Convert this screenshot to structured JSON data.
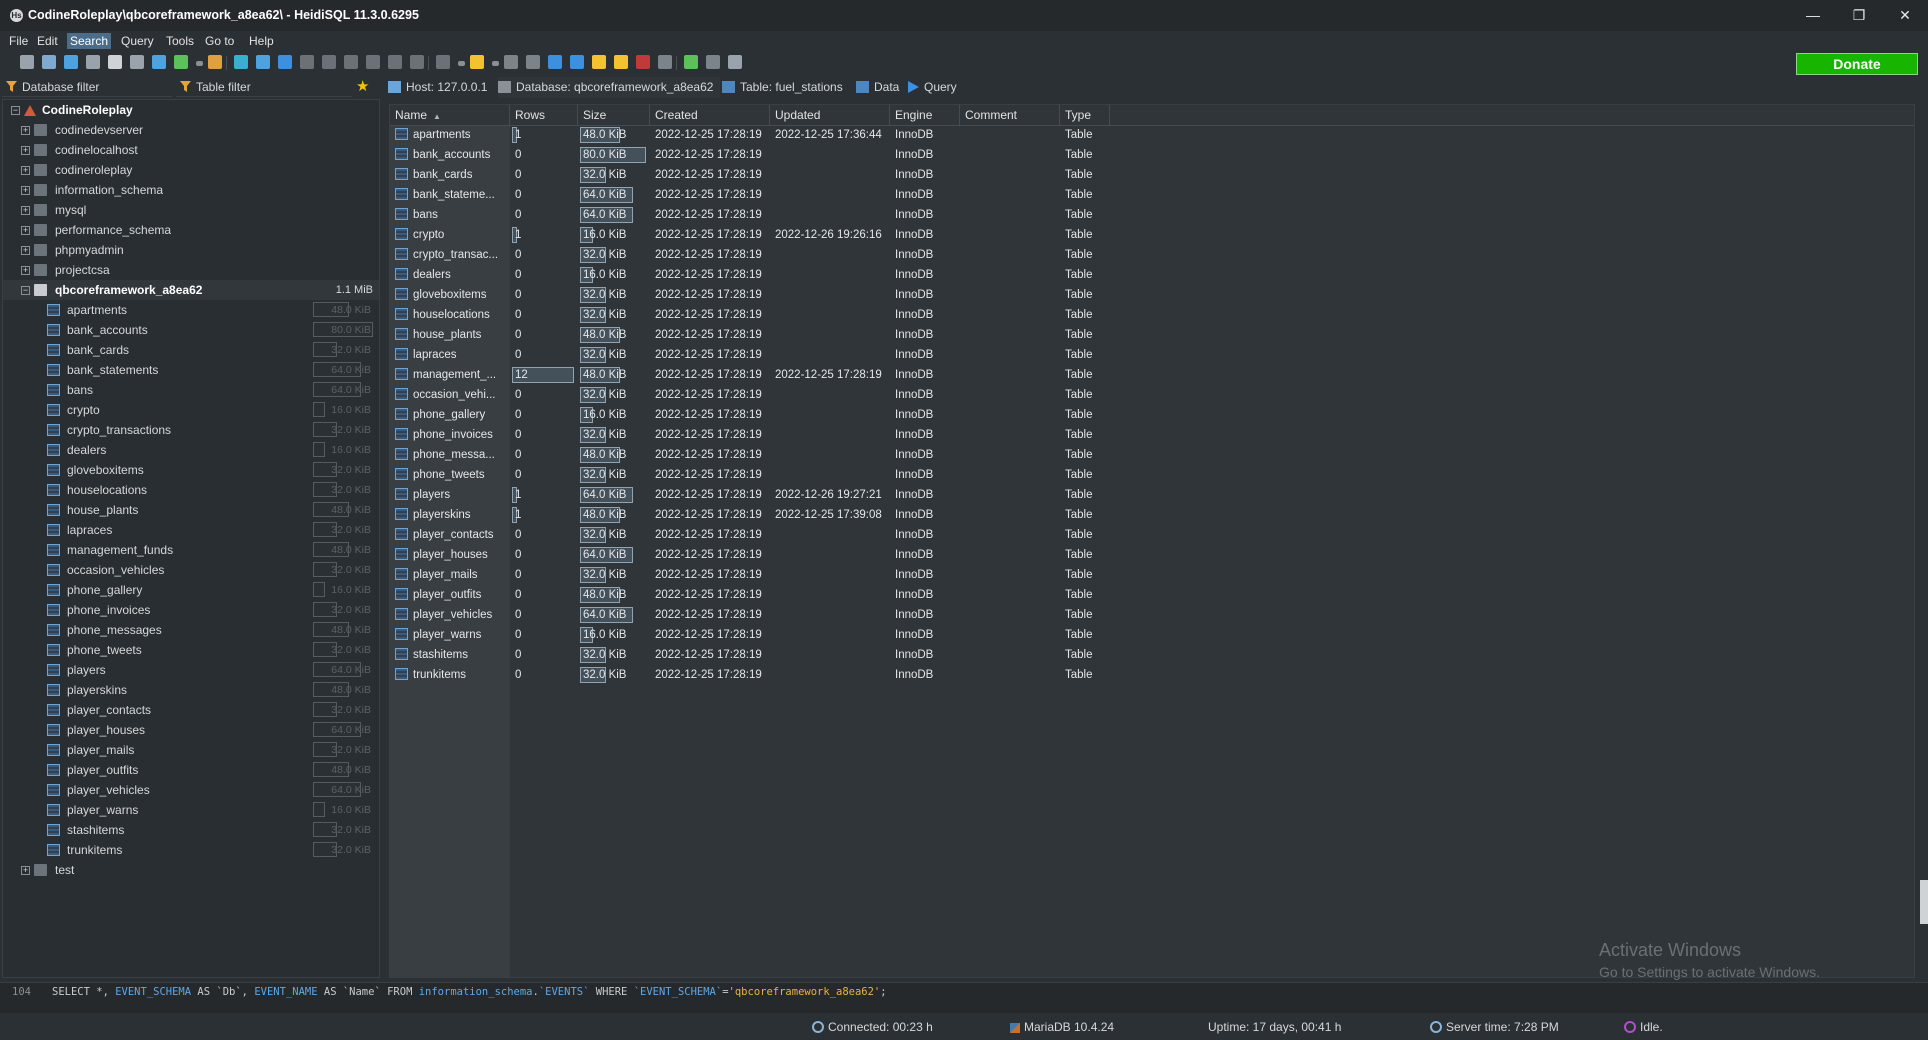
{
  "window": {
    "title": "CodineRoleplay\\qbcoreframework_a8ea62\\ - HeidiSQL 11.3.0.6295",
    "app_icon": "Hs",
    "controls": {
      "minimize": "—",
      "restore": "❐",
      "close": "✕"
    }
  },
  "menu": [
    "File",
    "Edit",
    "Search",
    "Query",
    "Tools",
    "Go to",
    "Help"
  ],
  "menu_active": "Search",
  "toolbar": {
    "donate_label": "Donate",
    "icons": [
      "connection-manager-icon",
      "disconnect-icon",
      "new-connection-icon",
      "copy-icon",
      "paste-icon",
      "undo-icon",
      "save-icon",
      "refresh-icon",
      "dropdown-icon",
      "user-manager-icon",
      "export-icon",
      "maintenance-icon",
      "help-icon",
      "first-icon",
      "last-icon",
      "insert-icon",
      "delete-icon",
      "post-icon",
      "cancel-icon",
      "run-icon",
      "run-dropdown-icon",
      "open-file-icon",
      "open-dropdown-icon",
      "save-sql-icon",
      "print-icon",
      "find-icon",
      "find-replace-icon",
      "format-icon",
      "warning-icon",
      "warnings-list-icon",
      "wrap-icon",
      "refresh-data-icon",
      "more-icon",
      "close-tab-icon"
    ]
  },
  "filters": {
    "database_filter": "Database filter",
    "table_filter": "Table filter"
  },
  "tabs": [
    {
      "label": "Host: 127.0.0.1",
      "icon": "host-icon",
      "active": false
    },
    {
      "label": "Database: qbcoreframework_a8ea62",
      "icon": "database-icon",
      "active": true
    },
    {
      "label": "Table: fuel_stations",
      "icon": "table-icon",
      "active": false
    },
    {
      "label": "Data",
      "icon": "grid-icon",
      "active": false
    },
    {
      "label": "Query",
      "icon": "play-icon",
      "active": false
    }
  ],
  "tree": {
    "root": "CodineRoleplay",
    "databases": [
      "codinedevserver",
      "codinelocalhost",
      "codineroleplay",
      "information_schema",
      "mysql",
      "performance_schema",
      "phpmyadmin",
      "projectcsa"
    ],
    "selected_db": {
      "name": "qbcoreframework_a8ea62",
      "size": "1.1 MiB"
    },
    "tables": [
      {
        "name": "apartments",
        "size": "48.0 KiB",
        "fraction": 0.6
      },
      {
        "name": "bank_accounts",
        "size": "80.0 KiB",
        "fraction": 1.0
      },
      {
        "name": "bank_cards",
        "size": "32.0 KiB",
        "fraction": 0.4
      },
      {
        "name": "bank_statements",
        "size": "64.0 KiB",
        "fraction": 0.8
      },
      {
        "name": "bans",
        "size": "64.0 KiB",
        "fraction": 0.8
      },
      {
        "name": "crypto",
        "size": "16.0 KiB",
        "fraction": 0.2
      },
      {
        "name": "crypto_transactions",
        "size": "32.0 KiB",
        "fraction": 0.4
      },
      {
        "name": "dealers",
        "size": "16.0 KiB",
        "fraction": 0.2
      },
      {
        "name": "gloveboxitems",
        "size": "32.0 KiB",
        "fraction": 0.4
      },
      {
        "name": "houselocations",
        "size": "32.0 KiB",
        "fraction": 0.4
      },
      {
        "name": "house_plants",
        "size": "48.0 KiB",
        "fraction": 0.6
      },
      {
        "name": "lapraces",
        "size": "32.0 KiB",
        "fraction": 0.4
      },
      {
        "name": "management_funds",
        "size": "48.0 KiB",
        "fraction": 0.6
      },
      {
        "name": "occasion_vehicles",
        "size": "32.0 KiB",
        "fraction": 0.4
      },
      {
        "name": "phone_gallery",
        "size": "16.0 KiB",
        "fraction": 0.2
      },
      {
        "name": "phone_invoices",
        "size": "32.0 KiB",
        "fraction": 0.4
      },
      {
        "name": "phone_messages",
        "size": "48.0 KiB",
        "fraction": 0.6
      },
      {
        "name": "phone_tweets",
        "size": "32.0 KiB",
        "fraction": 0.4
      },
      {
        "name": "players",
        "size": "64.0 KiB",
        "fraction": 0.8
      },
      {
        "name": "playerskins",
        "size": "48.0 KiB",
        "fraction": 0.6
      },
      {
        "name": "player_contacts",
        "size": "32.0 KiB",
        "fraction": 0.4
      },
      {
        "name": "player_houses",
        "size": "64.0 KiB",
        "fraction": 0.8
      },
      {
        "name": "player_mails",
        "size": "32.0 KiB",
        "fraction": 0.4
      },
      {
        "name": "player_outfits",
        "size": "48.0 KiB",
        "fraction": 0.6
      },
      {
        "name": "player_vehicles",
        "size": "64.0 KiB",
        "fraction": 0.8
      },
      {
        "name": "player_warns",
        "size": "16.0 KiB",
        "fraction": 0.2
      },
      {
        "name": "stashitems",
        "size": "32.0 KiB",
        "fraction": 0.4
      },
      {
        "name": "trunkitems",
        "size": "32.0 KiB",
        "fraction": 0.4
      }
    ],
    "after": [
      "test"
    ]
  },
  "grid": {
    "columns": [
      "Name",
      "Rows",
      "Size",
      "Created",
      "Updated",
      "Engine",
      "Comment",
      "Type"
    ],
    "sort_indicator": "▲",
    "rows": [
      {
        "name": "apartments",
        "rows": "1",
        "rows_fraction": 0.08,
        "size": "48.0 KiB",
        "size_fraction": 0.6,
        "created": "2022-12-25 17:28:19",
        "updated": "2022-12-25 17:36:44",
        "engine": "InnoDB",
        "comment": "",
        "type": "Table"
      },
      {
        "name": "bank_accounts",
        "rows": "0",
        "rows_fraction": 0,
        "size": "80.0 KiB",
        "size_fraction": 1.0,
        "created": "2022-12-25 17:28:19",
        "updated": "",
        "engine": "InnoDB",
        "comment": "",
        "type": "Table"
      },
      {
        "name": "bank_cards",
        "rows": "0",
        "rows_fraction": 0,
        "size": "32.0 KiB",
        "size_fraction": 0.4,
        "created": "2022-12-25 17:28:19",
        "updated": "",
        "engine": "InnoDB",
        "comment": "",
        "type": "Table"
      },
      {
        "name": "bank_stateme...",
        "rows": "0",
        "rows_fraction": 0,
        "size": "64.0 KiB",
        "size_fraction": 0.8,
        "created": "2022-12-25 17:28:19",
        "updated": "",
        "engine": "InnoDB",
        "comment": "",
        "type": "Table"
      },
      {
        "name": "bans",
        "rows": "0",
        "rows_fraction": 0,
        "size": "64.0 KiB",
        "size_fraction": 0.8,
        "created": "2022-12-25 17:28:19",
        "updated": "",
        "engine": "InnoDB",
        "comment": "",
        "type": "Table"
      },
      {
        "name": "crypto",
        "rows": "1",
        "rows_fraction": 0.08,
        "size": "16.0 KiB",
        "size_fraction": 0.2,
        "created": "2022-12-25 17:28:19",
        "updated": "2022-12-26 19:26:16",
        "engine": "InnoDB",
        "comment": "",
        "type": "Table"
      },
      {
        "name": "crypto_transac...",
        "rows": "0",
        "rows_fraction": 0,
        "size": "32.0 KiB",
        "size_fraction": 0.4,
        "created": "2022-12-25 17:28:19",
        "updated": "",
        "engine": "InnoDB",
        "comment": "",
        "type": "Table"
      },
      {
        "name": "dealers",
        "rows": "0",
        "rows_fraction": 0,
        "size": "16.0 KiB",
        "size_fraction": 0.2,
        "created": "2022-12-25 17:28:19",
        "updated": "",
        "engine": "InnoDB",
        "comment": "",
        "type": "Table"
      },
      {
        "name": "gloveboxitems",
        "rows": "0",
        "rows_fraction": 0,
        "size": "32.0 KiB",
        "size_fraction": 0.4,
        "created": "2022-12-25 17:28:19",
        "updated": "",
        "engine": "InnoDB",
        "comment": "",
        "type": "Table"
      },
      {
        "name": "houselocations",
        "rows": "0",
        "rows_fraction": 0,
        "size": "32.0 KiB",
        "size_fraction": 0.4,
        "created": "2022-12-25 17:28:19",
        "updated": "",
        "engine": "InnoDB",
        "comment": "",
        "type": "Table"
      },
      {
        "name": "house_plants",
        "rows": "0",
        "rows_fraction": 0,
        "size": "48.0 KiB",
        "size_fraction": 0.6,
        "created": "2022-12-25 17:28:19",
        "updated": "",
        "engine": "InnoDB",
        "comment": "",
        "type": "Table"
      },
      {
        "name": "lapraces",
        "rows": "0",
        "rows_fraction": 0,
        "size": "32.0 KiB",
        "size_fraction": 0.4,
        "created": "2022-12-25 17:28:19",
        "updated": "",
        "engine": "InnoDB",
        "comment": "",
        "type": "Table"
      },
      {
        "name": "management_...",
        "rows": "12",
        "rows_fraction": 1.0,
        "size": "48.0 KiB",
        "size_fraction": 0.6,
        "created": "2022-12-25 17:28:19",
        "updated": "2022-12-25 17:28:19",
        "engine": "InnoDB",
        "comment": "",
        "type": "Table"
      },
      {
        "name": "occasion_vehi...",
        "rows": "0",
        "rows_fraction": 0,
        "size": "32.0 KiB",
        "size_fraction": 0.4,
        "created": "2022-12-25 17:28:19",
        "updated": "",
        "engine": "InnoDB",
        "comment": "",
        "type": "Table"
      },
      {
        "name": "phone_gallery",
        "rows": "0",
        "rows_fraction": 0,
        "size": "16.0 KiB",
        "size_fraction": 0.2,
        "created": "2022-12-25 17:28:19",
        "updated": "",
        "engine": "InnoDB",
        "comment": "",
        "type": "Table"
      },
      {
        "name": "phone_invoices",
        "rows": "0",
        "rows_fraction": 0,
        "size": "32.0 KiB",
        "size_fraction": 0.4,
        "created": "2022-12-25 17:28:19",
        "updated": "",
        "engine": "InnoDB",
        "comment": "",
        "type": "Table"
      },
      {
        "name": "phone_messa...",
        "rows": "0",
        "rows_fraction": 0,
        "size": "48.0 KiB",
        "size_fraction": 0.6,
        "created": "2022-12-25 17:28:19",
        "updated": "",
        "engine": "InnoDB",
        "comment": "",
        "type": "Table"
      },
      {
        "name": "phone_tweets",
        "rows": "0",
        "rows_fraction": 0,
        "size": "32.0 KiB",
        "size_fraction": 0.4,
        "created": "2022-12-25 17:28:19",
        "updated": "",
        "engine": "InnoDB",
        "comment": "",
        "type": "Table"
      },
      {
        "name": "players",
        "rows": "1",
        "rows_fraction": 0.08,
        "size": "64.0 KiB",
        "size_fraction": 0.8,
        "created": "2022-12-25 17:28:19",
        "updated": "2022-12-26 19:27:21",
        "engine": "InnoDB",
        "comment": "",
        "type": "Table"
      },
      {
        "name": "playerskins",
        "rows": "1",
        "rows_fraction": 0.08,
        "size": "48.0 KiB",
        "size_fraction": 0.6,
        "created": "2022-12-25 17:28:19",
        "updated": "2022-12-25 17:39:08",
        "engine": "InnoDB",
        "comment": "",
        "type": "Table"
      },
      {
        "name": "player_contacts",
        "rows": "0",
        "rows_fraction": 0,
        "size": "32.0 KiB",
        "size_fraction": 0.4,
        "created": "2022-12-25 17:28:19",
        "updated": "",
        "engine": "InnoDB",
        "comment": "",
        "type": "Table"
      },
      {
        "name": "player_houses",
        "rows": "0",
        "rows_fraction": 0,
        "size": "64.0 KiB",
        "size_fraction": 0.8,
        "created": "2022-12-25 17:28:19",
        "updated": "",
        "engine": "InnoDB",
        "comment": "",
        "type": "Table"
      },
      {
        "name": "player_mails",
        "rows": "0",
        "rows_fraction": 0,
        "size": "32.0 KiB",
        "size_fraction": 0.4,
        "created": "2022-12-25 17:28:19",
        "updated": "",
        "engine": "InnoDB",
        "comment": "",
        "type": "Table"
      },
      {
        "name": "player_outfits",
        "rows": "0",
        "rows_fraction": 0,
        "size": "48.0 KiB",
        "size_fraction": 0.6,
        "created": "2022-12-25 17:28:19",
        "updated": "",
        "engine": "InnoDB",
        "comment": "",
        "type": "Table"
      },
      {
        "name": "player_vehicles",
        "rows": "0",
        "rows_fraction": 0,
        "size": "64.0 KiB",
        "size_fraction": 0.8,
        "created": "2022-12-25 17:28:19",
        "updated": "",
        "engine": "InnoDB",
        "comment": "",
        "type": "Table"
      },
      {
        "name": "player_warns",
        "rows": "0",
        "rows_fraction": 0,
        "size": "16.0 KiB",
        "size_fraction": 0.2,
        "created": "2022-12-25 17:28:19",
        "updated": "",
        "engine": "InnoDB",
        "comment": "",
        "type": "Table"
      },
      {
        "name": "stashitems",
        "rows": "0",
        "rows_fraction": 0,
        "size": "32.0 KiB",
        "size_fraction": 0.4,
        "created": "2022-12-25 17:28:19",
        "updated": "",
        "engine": "InnoDB",
        "comment": "",
        "type": "Table"
      },
      {
        "name": "trunkitems",
        "rows": "0",
        "rows_fraction": 0,
        "size": "32.0 KiB",
        "size_fraction": 0.4,
        "created": "2022-12-25 17:28:19",
        "updated": "",
        "engine": "InnoDB",
        "comment": "",
        "type": "Table"
      }
    ]
  },
  "watermark": {
    "line1": "Activate Windows",
    "line2": "Go to Settings to activate Windows."
  },
  "sql_log": {
    "line_number": "104",
    "tokens": [
      {
        "t": "SELECT *, ",
        "c": "kw"
      },
      {
        "t": "EVENT_SCHEMA",
        "c": "fn"
      },
      {
        "t": " AS ",
        "c": "kw"
      },
      {
        "t": "`Db`",
        "c": "id"
      },
      {
        "t": ", ",
        "c": "kw"
      },
      {
        "t": "EVENT_NAME",
        "c": "fn"
      },
      {
        "t": " AS ",
        "c": "kw"
      },
      {
        "t": "`Name`",
        "c": "id"
      },
      {
        "t": " FROM ",
        "c": "kw"
      },
      {
        "t": "information_schema",
        "c": "fn"
      },
      {
        "t": ".",
        "c": "kw"
      },
      {
        "t": "`EVENTS`",
        "c": "fn"
      },
      {
        "t": " WHERE ",
        "c": "kw"
      },
      {
        "t": "`EVENT_SCHEMA`",
        "c": "fn"
      },
      {
        "t": "=",
        "c": "kw"
      },
      {
        "t": "'qbcoreframework_a8ea62'",
        "c": "str"
      },
      {
        "t": ";",
        "c": "kw"
      }
    ]
  },
  "status": {
    "connected": "Connected: 00:23 h",
    "server": "MariaDB 10.4.24",
    "uptime": "Uptime: 17 days, 00:41 h",
    "server_time": "Server time: 7:28 PM",
    "state": "Idle."
  },
  "colors": {
    "accent": "#4c6d8a",
    "donate": "#17b400",
    "background": "#2b3034"
  }
}
